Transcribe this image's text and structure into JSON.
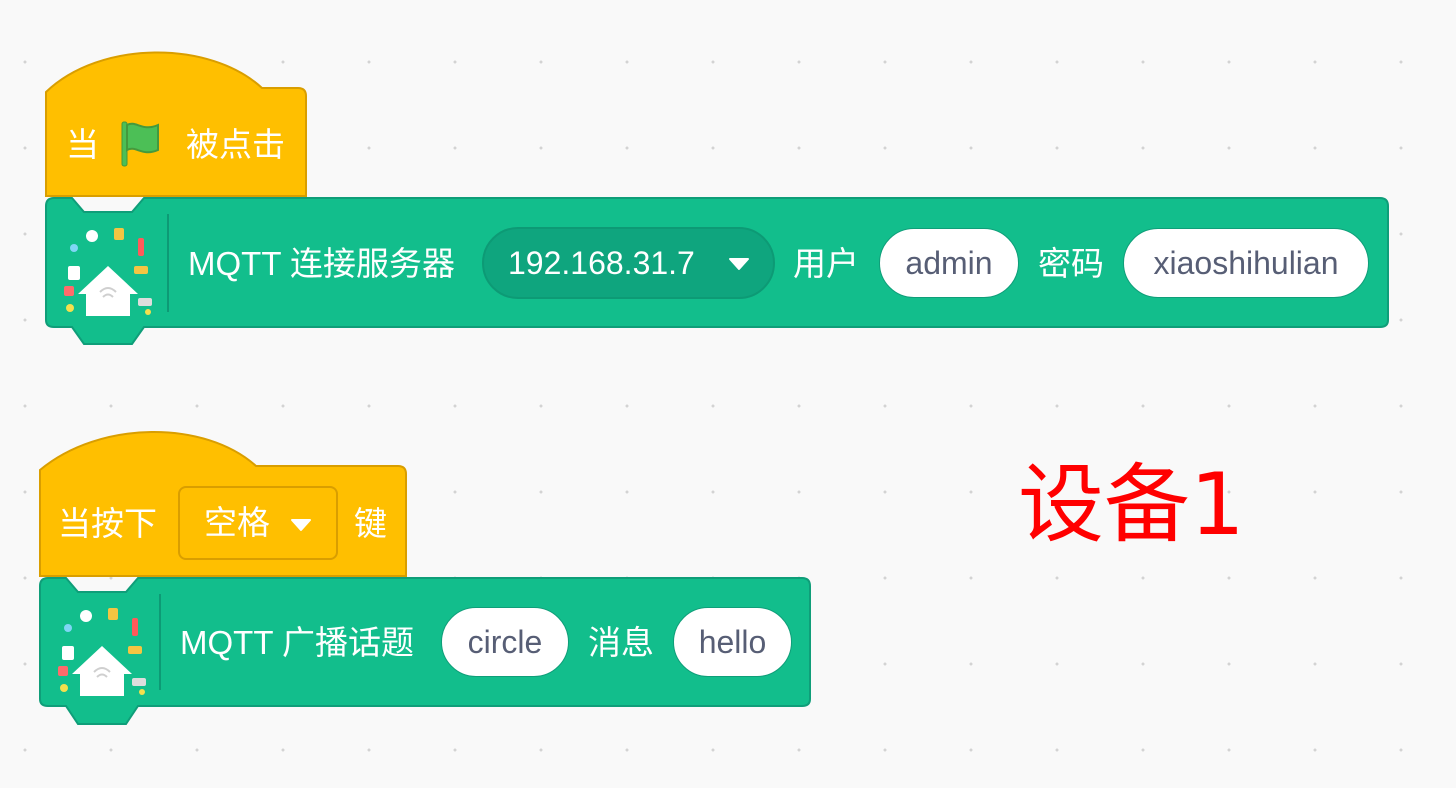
{
  "script1": {
    "hat_prefix": "当",
    "hat_suffix": "被点击",
    "command": "MQTT 连接服务器",
    "server": "192.168.31.7",
    "user_label": "用户",
    "user_value": "admin",
    "password_label": "密码",
    "password_value": "xiaoshihulian"
  },
  "script2": {
    "hat_prefix": "当按下",
    "key": "空格",
    "hat_suffix": "键",
    "command": "MQTT 广播话题",
    "topic": "circle",
    "message_label": "消息",
    "message": "hello"
  },
  "annotation": "设备1",
  "icons": [
    "green-flag-icon",
    "iot-smart-home-icon",
    "dropdown-arrow-icon"
  ],
  "colors": {
    "event_block": "#ffbf00",
    "extension_block": "#12be8c",
    "annotation": "#ff0000"
  }
}
